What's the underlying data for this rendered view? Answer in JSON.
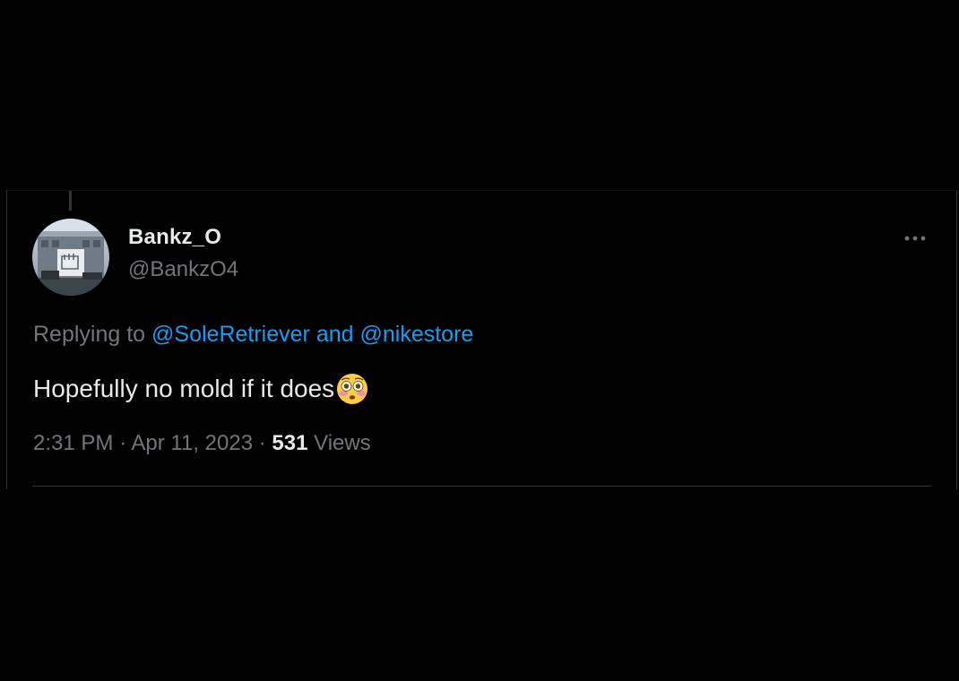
{
  "tweet": {
    "author_name": "Bankz_O",
    "author_handle": "@BankzO4",
    "replying_prefix": "Replying to",
    "mention_1": "@SoleRetriever",
    "mention_joiner": "and",
    "mention_2": "@nikestore",
    "text": "Hopefully no mold if it does",
    "emoji": "flushed-face-icon",
    "time": "2:31 PM",
    "separator": "·",
    "date": "Apr 11, 2023",
    "views_count": "531",
    "views_label": "Views"
  },
  "colors": {
    "background": "#000000",
    "primary_text": "#e7e9ea",
    "secondary_text": "#71767b",
    "accent": "#1d9bf0",
    "border": "#2f3336"
  },
  "icons": {
    "more": "more-dots-icon",
    "avatar": "avatar"
  }
}
